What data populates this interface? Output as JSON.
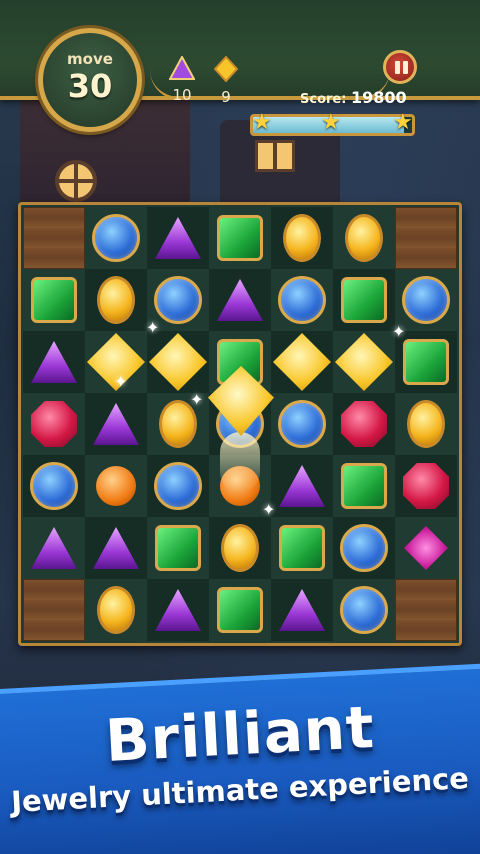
{
  "hud": {
    "move_label": "move",
    "move_value": "30",
    "goals": [
      {
        "gem": "purple-triangle-gem",
        "count": "10"
      },
      {
        "gem": "yellow-diamond-gem",
        "count": "9"
      }
    ],
    "score_label": "Score:",
    "score_value": "19800",
    "progress_fraction": 0.95,
    "stars_earned": 3
  },
  "board": {
    "rows": [
      [
        "wood",
        "blue",
        "purple",
        "green",
        "yellow",
        "yellow",
        "wood"
      ],
      [
        "green",
        "yellow",
        "blue",
        "purple",
        "blue",
        "green",
        "blue"
      ],
      [
        "purple",
        "big-yellow",
        "big-yellow",
        "green",
        "big-yellow",
        "big-yellow",
        "green"
      ],
      [
        "red",
        "purple",
        "yellow",
        "blue",
        "blue",
        "red",
        "yellow"
      ],
      [
        "blue",
        "orange-bomb",
        "blue",
        "orange-bomb",
        "purple",
        "green",
        "red"
      ],
      [
        "purple",
        "purple",
        "green",
        "yellow",
        "green",
        "blue",
        "special-pink"
      ],
      [
        "wood",
        "yellow",
        "purple",
        "green",
        "purple",
        "blue",
        "wood"
      ]
    ]
  },
  "banner": {
    "headline": "Brilliant",
    "subhead": "Jewelry ultimate experience"
  },
  "colors": {
    "accent_gold": "#c99a3c",
    "banner_blue": "#1a5bc0",
    "star": "#ffd23c"
  }
}
